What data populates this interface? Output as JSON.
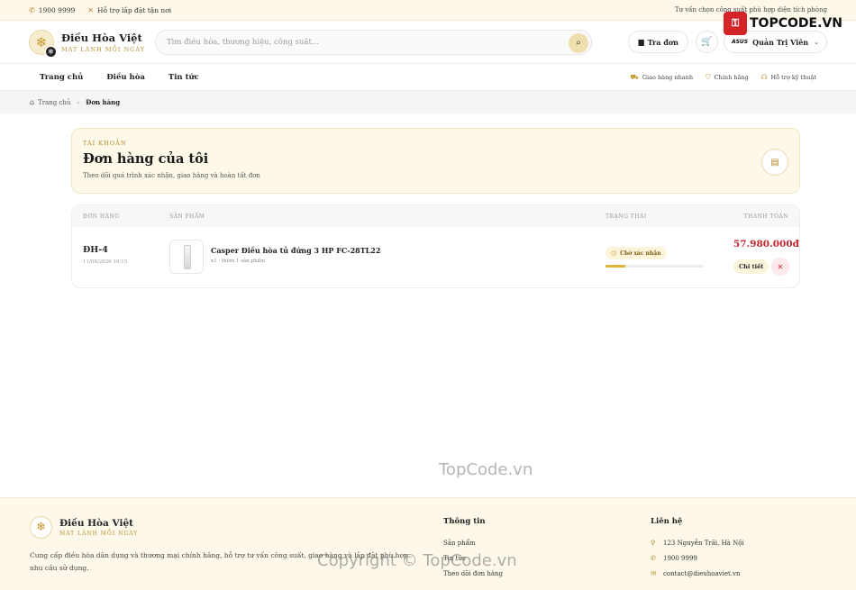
{
  "topbar": {
    "phone": "1900 9999",
    "install": "Hỗ trợ lắp đặt tận nơi",
    "right_text": "Tư vấn chọn công suất phù hợp diện tích phòng"
  },
  "brand": {
    "name": "Điều Hòa Việt",
    "tagline": "MÁT LÀNH MỖI NGÀY"
  },
  "search": {
    "placeholder": "Tìm điều hòa, thương hiệu, công suất..."
  },
  "header": {
    "track_label": "Tra đơn",
    "user_brand": "ASUS",
    "user_name": "Quản Trị Viên"
  },
  "nav": {
    "items": [
      "Trang chủ",
      "Điều hòa",
      "Tin tức"
    ],
    "features": [
      "Giao hàng nhanh",
      "Chính hãng",
      "Hỗ trợ kỹ thuật"
    ]
  },
  "breadcrumb": {
    "home": "Trang chủ",
    "current": "Đơn hàng"
  },
  "account": {
    "label": "TÀI KHOẢN",
    "title": "Đơn hàng của tôi",
    "subtitle": "Theo dõi quá trình xác nhận, giao hàng và hoàn tất đơn"
  },
  "orders": {
    "columns": [
      "ĐƠN HÀNG",
      "SẢN PHẨM",
      "TRẠNG THÁI",
      "THANH TOÁN"
    ],
    "rows": [
      {
        "id": "ĐH-4",
        "date": "11/08/2026 16:15",
        "product": "Casper Điều hòa tủ đứng 3 HP FC-28TL22",
        "meta": "x1 · thêm 1 sản phẩm",
        "status": "Chờ xác nhận",
        "progress": 0.2,
        "total": "57.980.000đ",
        "detail_label": "Chi tiết"
      }
    ]
  },
  "watermarks": {
    "center": "TopCode.vn",
    "corner": "TOPCODE.VN",
    "copyright": "Copyright © TopCode.vn"
  },
  "footer": {
    "description": "Cung cấp điều hòa dân dụng và thương mại chính hãng, hỗ trợ tư vấn công suất, giao hàng và lắp đặt phù hợp nhu cầu sử dụng.",
    "info_title": "Thông tin",
    "info_links": [
      "Sản phẩm",
      "Tin tức",
      "Theo dõi đơn hàng"
    ],
    "contact_title": "Liên hệ",
    "address": "123 Nguyễn Trãi, Hà Nội",
    "phone": "1900 9999",
    "email": "contact@dieuhoaviet.vn"
  },
  "colors": {
    "accent": "#c39a2e",
    "price": "#c0262d",
    "cream": "#fdf8ea"
  }
}
